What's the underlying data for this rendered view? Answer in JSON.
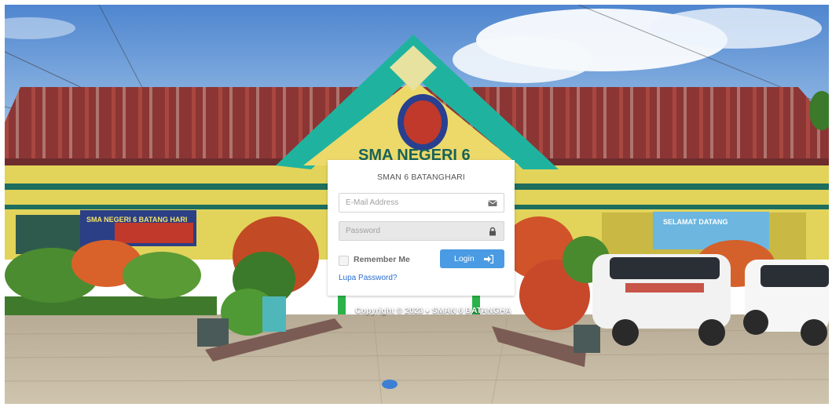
{
  "login": {
    "school_title": "SMAN 6 BATANGHARI",
    "email_placeholder": "E-Mail Address",
    "password_placeholder": "Password",
    "remember_label": "Remember Me",
    "login_label": "Login",
    "forgot_label": "Lupa Password?"
  },
  "background": {
    "building_sign": "SMA NEGERI 6",
    "banner_left": "SMA NEGERI 6 BATANG HARI",
    "banner_right": "SELAMAT DATANG"
  },
  "footer": {
    "copyright": "Copyright © 2023 ♦ SMAN 6 BATANGHA"
  },
  "icons": {
    "email": "envelope-icon",
    "password": "lock-icon",
    "login": "sign-in-icon"
  },
  "colors": {
    "login_button": "#4a9be3",
    "link": "#2a6fd0",
    "roof": "#8e3a3a",
    "trim": "#22a69a"
  }
}
